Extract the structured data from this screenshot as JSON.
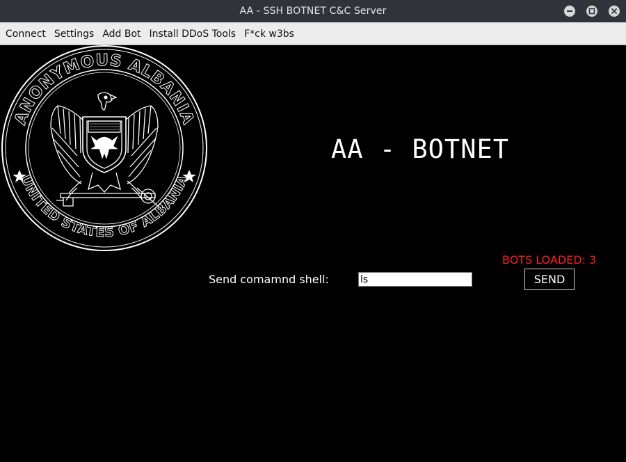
{
  "window": {
    "title": "AA - SSH BOTNET C&C Server",
    "controls": {
      "minimize_icon": "minimize-icon",
      "maximize_icon": "maximize-icon",
      "close_icon": "close-icon"
    }
  },
  "menubar": {
    "items": [
      "Connect",
      "Settings",
      "Add Bot",
      "Install DDoS Tools",
      "F*ck w3bs"
    ]
  },
  "emblem": {
    "top_text": "ANONYMOUS ALBANIA",
    "bottom_text": "UNITED STATES OF ALBANIA",
    "icon": "eagle-seal-icon"
  },
  "main": {
    "heading": "AA - BOTNET",
    "bots_loaded": "BOTS LOADED: 3",
    "command_label": "Send comamnd shell:",
    "command_value": "ls",
    "send_label": "SEND"
  },
  "colors": {
    "background": "#000000",
    "bots_text": "#ff2020",
    "titlebar": "#30343a",
    "menubar": "#ececec"
  }
}
